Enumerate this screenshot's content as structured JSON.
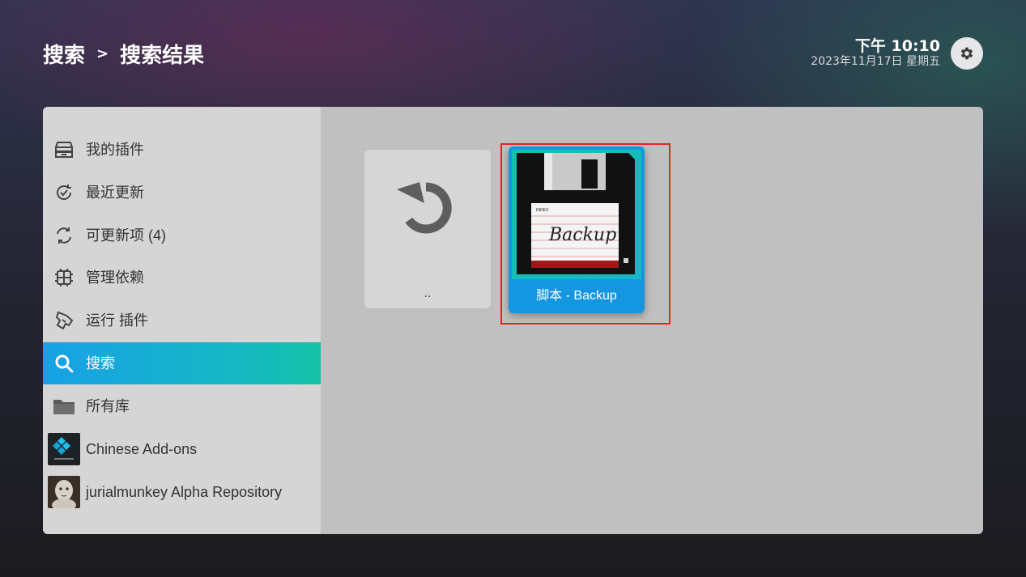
{
  "breadcrumb": {
    "parent": "搜索",
    "separator": ">",
    "current": "搜索结果"
  },
  "clock": {
    "time": "下午 10:10",
    "date": "2023年11月17日 星期五"
  },
  "sidebar": {
    "items": [
      {
        "label": "我的插件",
        "icon": "addon-box-icon"
      },
      {
        "label": "最近更新",
        "icon": "recently-updated-icon"
      },
      {
        "label": "可更新项 (4)",
        "icon": "available-updates-icon"
      },
      {
        "label": "管理依赖",
        "icon": "dependencies-icon"
      },
      {
        "label": "运行 插件",
        "icon": "running-addons-icon"
      },
      {
        "label": "搜索",
        "icon": "search-icon",
        "active": true
      },
      {
        "label": "所有库",
        "icon": "folder-icon"
      },
      {
        "label": "Chinese Add-ons",
        "icon": "kodi-repo-thumbnail"
      },
      {
        "label": "jurialmunkey Alpha Repository",
        "icon": "repo-avatar-thumbnail"
      }
    ]
  },
  "results": {
    "back_tile": {
      "label": "..",
      "icon": "back-arrow-icon"
    },
    "items": [
      {
        "label": "脚本 - Backup",
        "thumb_text": "Backup",
        "thumb_index": "INDEX",
        "icon": "floppy-disk-icon",
        "selected": true
      }
    ]
  },
  "colors": {
    "accent_start": "#17a1e6",
    "accent_end": "#17c3a8",
    "selected_tile": "#1496e0",
    "highlight": "#e52323"
  }
}
